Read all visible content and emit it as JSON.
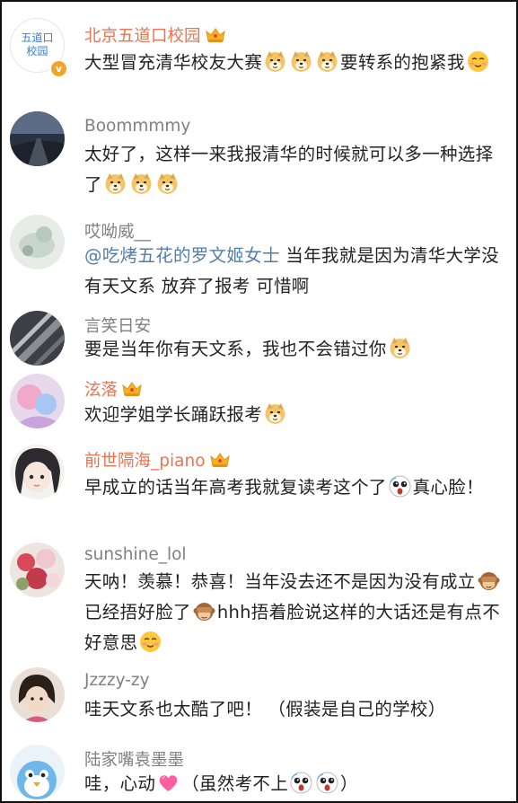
{
  "comments": [
    {
      "name": "北京五道口校园",
      "avatar_label": "五道口\n校园",
      "verified": true,
      "segments": [
        {
          "t": "大型冒充清华校友大赛"
        },
        {
          "e": "doge-emoji"
        },
        {
          "e": "doge-emoji"
        },
        {
          "e": "doge-emoji"
        },
        {
          "t": "要转系的抱紧我"
        },
        {
          "e": "smug-face-emoji"
        }
      ]
    },
    {
      "name": "Boommmmy",
      "segments": [
        {
          "t": "太好了，这样一来我报清华的时候就可以多一种选择了"
        },
        {
          "e": "doge-emoji"
        },
        {
          "e": "doge-emoji"
        },
        {
          "e": "doge-emoji"
        }
      ]
    },
    {
      "name": "哎呦威__",
      "segments": [
        {
          "m": "@吃烤五花的罗文姬女士"
        },
        {
          "t": " 当年我就是因为清华大学没有天文系 放弃了报考 可惜啊"
        }
      ]
    },
    {
      "name": "言笑日安",
      "segments": [
        {
          "t": "要是当年你有天文系，我也不会错过你"
        },
        {
          "e": "doge-emoji"
        }
      ]
    },
    {
      "name": "泫落",
      "segments": [
        {
          "t": "欢迎学姐学长踊跃报考"
        },
        {
          "e": "doge-emoji"
        }
      ]
    },
    {
      "name": "前世隔海_piano",
      "segments": [
        {
          "t": "早成立的话当年高考我就复读考这个了"
        },
        {
          "e": "shocked-face-emoji"
        },
        {
          "t": "真心脸！"
        }
      ]
    },
    {
      "name": "sunshine_lol",
      "segments": [
        {
          "t": "天呐！羡慕！恭喜！当年没去还不是因为没有成立"
        },
        {
          "e": "see-no-evil-monkey-emoji"
        },
        {
          "t": "已经捂好脸了"
        },
        {
          "e": "see-no-evil-monkey-emoji"
        },
        {
          "t": "hhh捂着脸说这样的大话还是有点不好意思"
        },
        {
          "e": "smug-face-emoji"
        }
      ]
    },
    {
      "name": "Jzzzy-zy",
      "segments": [
        {
          "t": "哇天文系也太酷了吧！ （假装是自己的学校）"
        }
      ]
    },
    {
      "name": "陆家嘴袁墨墨",
      "segments": [
        {
          "t": "哇，心动"
        },
        {
          "e": "pink-heart-emoji"
        },
        {
          "t": "（虽然考不上"
        },
        {
          "e": "shocked-face-emoji"
        },
        {
          "e": "shocked-face-emoji"
        },
        {
          "t": "）"
        }
      ]
    }
  ]
}
